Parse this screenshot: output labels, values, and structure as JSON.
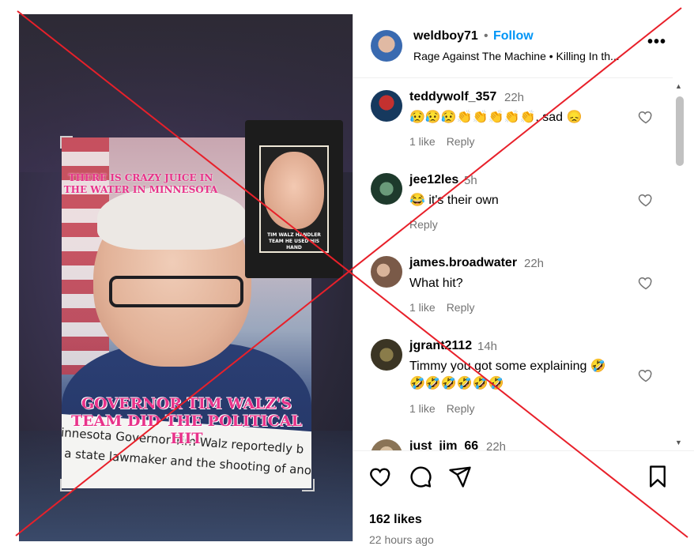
{
  "post": {
    "media": {
      "caption_top": "THERE IS CRAZY JUICE IN THE WATER IN MINNESOTA",
      "caption_bottom": "GOVERNOR TIM WALZ'S TEAM DID THE POLITICAL HIT",
      "news_line1": "linnesota Governor Tim Walz reportedly b",
      "news_line2": "f a state lawmaker and the shooting of anot",
      "inset_caption": "TIM WALZ HANDLER TEAM HE USED HIS HAND"
    },
    "header": {
      "username": "weldboy71",
      "separator": "•",
      "follow_label": "Follow",
      "audio": "Rage Against The Machine • Killing In th...",
      "more_label": "•••"
    },
    "comments": [
      {
        "username": "teddywolf_357",
        "time": "22h",
        "text": "😥😥😥👏👏👏👏👏, sad 😞",
        "likes": "1 like",
        "reply": "Reply"
      },
      {
        "username": "jee12les",
        "time": "5h",
        "text": "😂 it's their own",
        "likes": "",
        "reply": "Reply"
      },
      {
        "username": "james.broadwater",
        "time": "22h",
        "text": "What hit?",
        "likes": "1 like",
        "reply": "Reply"
      },
      {
        "username": "jgrant2112",
        "time": "14h",
        "text": "Timmy you got some explaining 🤣🤣🤣🤣🤣🤣🤣",
        "likes": "1 like",
        "reply": "Reply"
      },
      {
        "username": "just_jim_66",
        "time": "22h",
        "text": "",
        "likes": "",
        "reply": ""
      }
    ],
    "likes": "162 likes",
    "time_ago": "22 hours ago"
  },
  "colors": {
    "accent": "#0095f6",
    "mark": "#e8202a",
    "caption": "#e8338a"
  },
  "icons": [
    "heart-icon",
    "comment-icon",
    "share-icon",
    "bookmark-icon",
    "more-icon",
    "chevron-up-icon",
    "chevron-down-icon"
  ]
}
